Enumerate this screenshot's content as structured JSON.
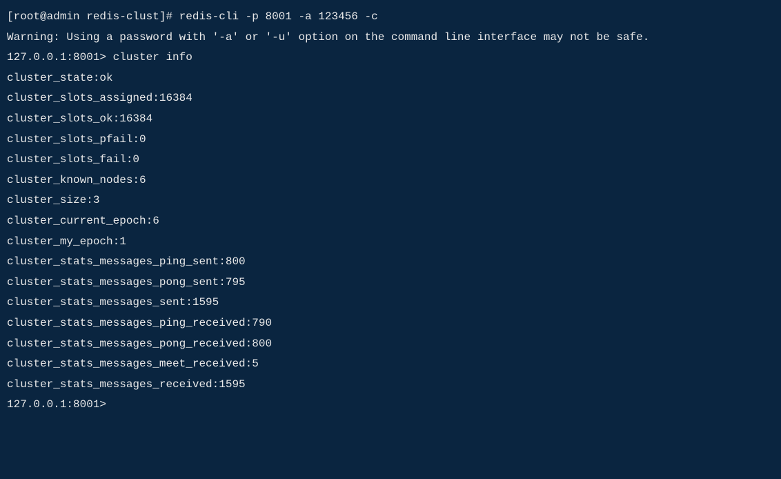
{
  "lines": {
    "shell_prompt": "[root@admin redis-clust]# ",
    "shell_command": "redis-cli -p 8001 -a 123456 -c",
    "warning": "Warning: Using a password with '-a' or '-u' option on the command line interface may not be safe.",
    "redis_prompt_1": "127.0.0.1:8001> ",
    "redis_command_1": "cluster info",
    "cluster_state": "cluster_state:ok",
    "cluster_slots_assigned": "cluster_slots_assigned:16384",
    "cluster_slots_ok": "cluster_slots_ok:16384",
    "cluster_slots_pfail": "cluster_slots_pfail:0",
    "cluster_slots_fail": "cluster_slots_fail:0",
    "cluster_known_nodes": "cluster_known_nodes:6",
    "cluster_size": "cluster_size:3",
    "cluster_current_epoch": "cluster_current_epoch:6",
    "cluster_my_epoch": "cluster_my_epoch:1",
    "cluster_stats_messages_ping_sent": "cluster_stats_messages_ping_sent:800",
    "cluster_stats_messages_pong_sent": "cluster_stats_messages_pong_sent:795",
    "cluster_stats_messages_sent": "cluster_stats_messages_sent:1595",
    "cluster_stats_messages_ping_received": "cluster_stats_messages_ping_received:790",
    "cluster_stats_messages_pong_received": "cluster_stats_messages_pong_received:800",
    "cluster_stats_messages_meet_received": "cluster_stats_messages_meet_received:5",
    "cluster_stats_messages_received": "cluster_stats_messages_received:1595",
    "redis_prompt_2": "127.0.0.1:8001> "
  }
}
